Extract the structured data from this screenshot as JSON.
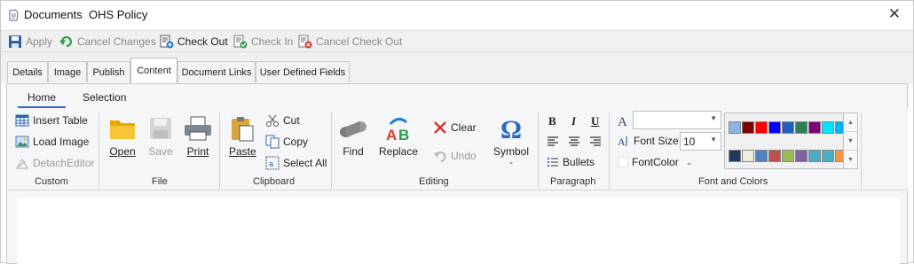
{
  "window": {
    "title": "Documents  OHS Policy",
    "close": "✕"
  },
  "toolbar": {
    "apply": "Apply",
    "cancel_changes": "Cancel Changes",
    "check_out": "Check Out",
    "check_in": "Check In",
    "cancel_check_out": "Cancel Check Out"
  },
  "tabs": [
    "Details",
    "Image",
    "Publish",
    "Content",
    "Document Links",
    "User Defined Fields"
  ],
  "active_tab": "Content",
  "ribbon": {
    "tabs": [
      "Home",
      "Selection"
    ],
    "active_tab": "Home",
    "custom": {
      "label": "Custom",
      "insert_table": "Insert Table",
      "load_image": "Load Image",
      "detach_editor": "DetachEditor"
    },
    "file": {
      "label": "File",
      "open": "Open",
      "save": "Save",
      "print": "Print"
    },
    "clipboard": {
      "label": "Clipboard",
      "paste": "Paste",
      "cut": "Cut",
      "copy": "Copy",
      "select_all": "Select All"
    },
    "editing": {
      "label": "Editing",
      "find": "Find",
      "replace": "Replace",
      "clear": "Clear",
      "undo": "Undo",
      "symbol": "Symbol",
      "symbol_glyph": "Ω"
    },
    "paragraph": {
      "label": "Paragraph",
      "bold": "B",
      "italic": "I",
      "underline": "U",
      "bullets": "Bullets"
    },
    "font": {
      "label": "Font and Colors",
      "font_name": "",
      "font_size_label": "Font Size",
      "font_size": "10",
      "font_color_label": "FontColor",
      "colors_row1": [
        "#8db3e2",
        "#7f0000",
        "#ff0000",
        "#0000ff",
        "#1f5fbf",
        "#2e7d5b",
        "#800080",
        "#00e5ff",
        "#00b0f0"
      ],
      "colors_row2": [
        "#1f3864",
        "#eeece1",
        "#4f81bd",
        "#c0504d",
        "#9bbb59",
        "#8064a2",
        "#4bacc6",
        "#4bacc6",
        "#f79646"
      ]
    }
  },
  "colors": {
    "accent": "#2a6ac8"
  }
}
